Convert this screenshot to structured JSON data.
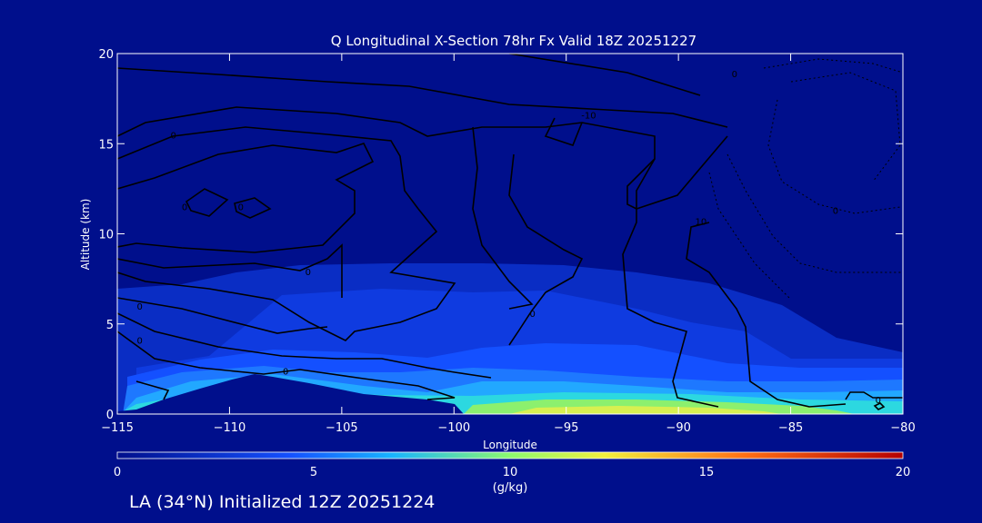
{
  "colors": {
    "background": "#000f8c",
    "frame": "#ffffff",
    "contour": "#000000"
  },
  "chart_data": {
    "type": "filled contour cross-section",
    "title": "Q Longitudinal X-Section 78hr  Fx Valid 18Z 20251227",
    "xlabel": "Longitude",
    "ylabel": "Altitude (km)",
    "xlim": [
      -115,
      -80
    ],
    "ylim": [
      0,
      20
    ],
    "xticks": [
      "−115",
      "−110",
      "−105",
      "−100",
      "−95",
      "−90",
      "−85",
      "−80"
    ],
    "yticks": [
      "0",
      "5",
      "10",
      "15",
      "20"
    ],
    "colorbar": {
      "label": "(g/kg)",
      "min": 0,
      "max": 20,
      "ticks": [
        "0",
        "5",
        "10",
        "15",
        "20"
      ]
    },
    "contour_labels": [
      {
        "text": "0",
        "lon": -87.5,
        "alt": 18.9
      },
      {
        "text": "-10",
        "lon": -94.0,
        "alt": 16.6
      },
      {
        "text": "0",
        "lon": -112.5,
        "alt": 15.5
      },
      {
        "text": "0",
        "lon": -112.0,
        "alt": 11.5
      },
      {
        "text": "0",
        "lon": -109.5,
        "alt": 11.5
      },
      {
        "text": "10",
        "lon": -89.0,
        "alt": 10.7
      },
      {
        "text": "0",
        "lon": -83.0,
        "alt": 11.3
      },
      {
        "text": "0",
        "lon": -106.5,
        "alt": 7.9
      },
      {
        "text": "0",
        "lon": -114.0,
        "alt": 6.0
      },
      {
        "text": "0",
        "lon": -96.5,
        "alt": 5.6
      },
      {
        "text": "0",
        "lon": -114.0,
        "alt": 4.1
      },
      {
        "text": "0",
        "lon": -107.5,
        "alt": 2.4
      },
      {
        "text": "0",
        "lon": -81.1,
        "alt": 0.8
      }
    ]
  },
  "footer": "LA (34°N) Initialized 12Z 20251224"
}
